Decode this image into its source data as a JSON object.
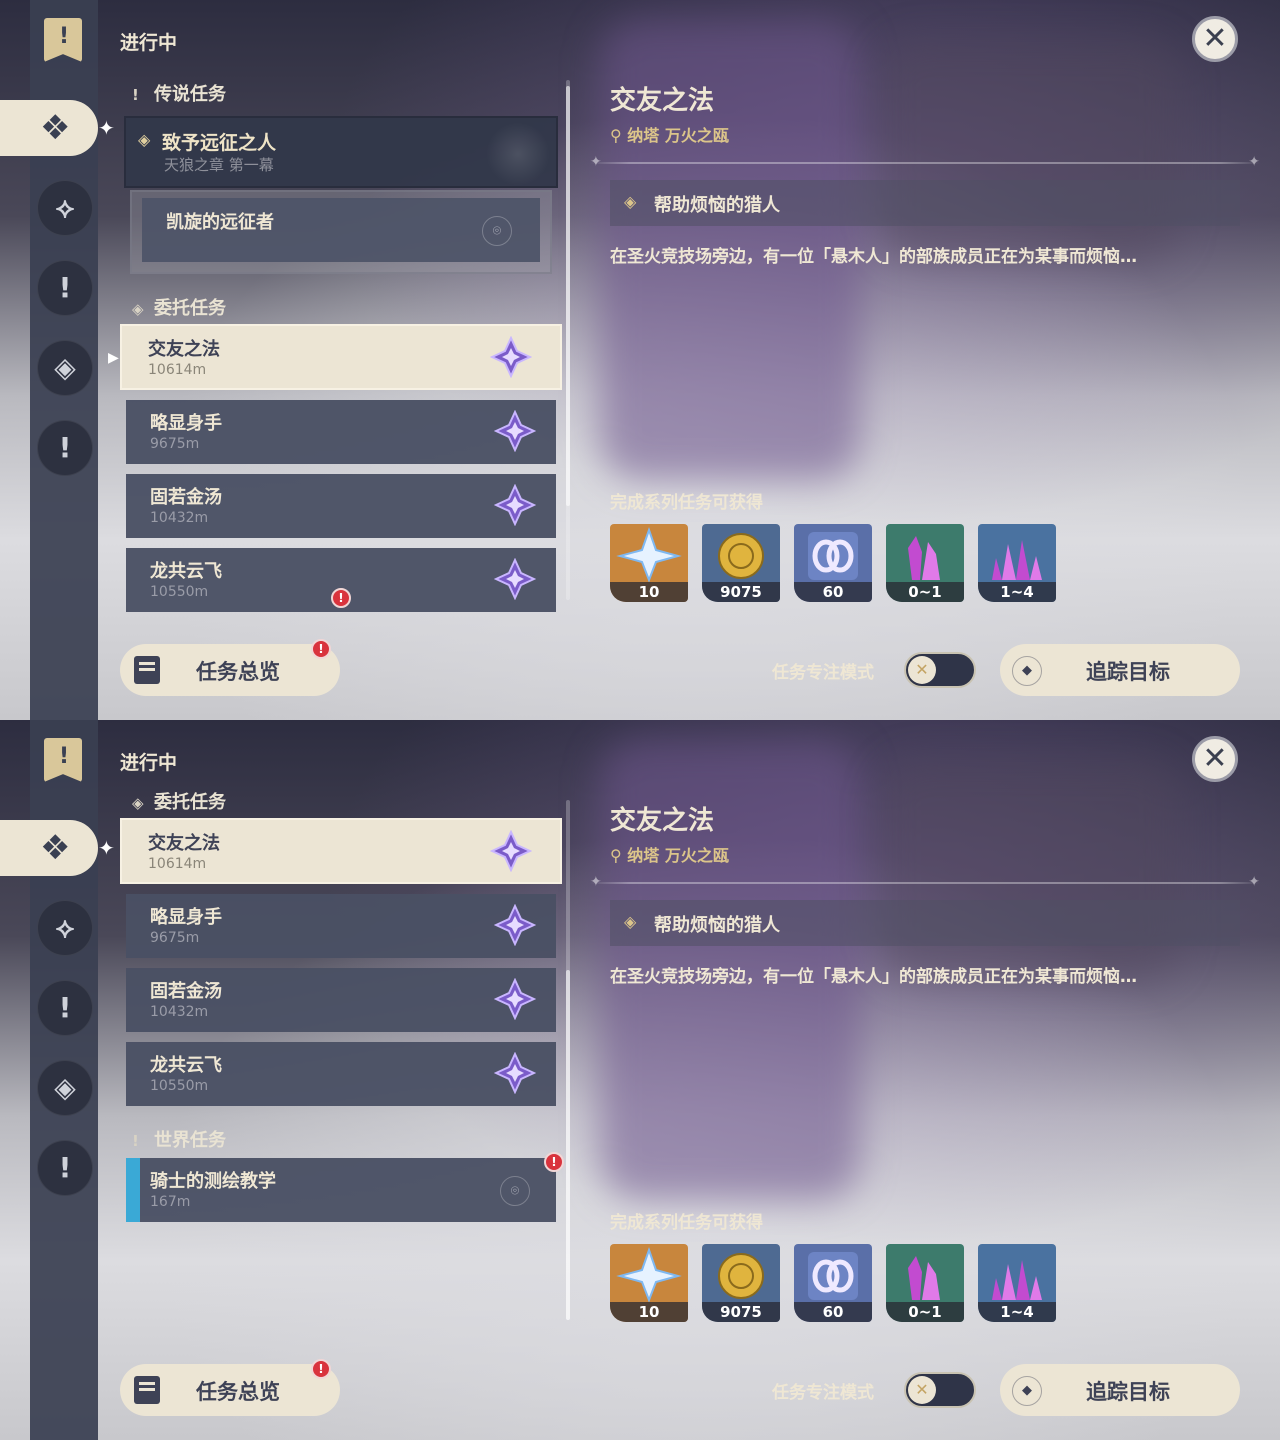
{
  "common": {
    "in_progress": "进行中",
    "overview_label": "任务总览",
    "focus_mode_label": "任务专注模式",
    "track_label": "追踪目标",
    "rewards_heading": "完成系列任务可获得"
  },
  "detail": {
    "title": "交友之法",
    "location": "纳塔 万火之瓯",
    "step": "帮助烦恼的猎人",
    "description": "在圣火竞技场旁边，有一位「悬木人」的部族成员正在为某事而烦恼…",
    "rewards": [
      {
        "icon": "primogem-icon",
        "count": "10"
      },
      {
        "icon": "mora-icon",
        "count": "9075"
      },
      {
        "icon": "adventure-exp-icon",
        "count": "60"
      },
      {
        "icon": "crystal-chunk-icon",
        "count": "0~1"
      },
      {
        "icon": "crystal-cluster-icon",
        "count": "1~4"
      }
    ]
  },
  "panel1": {
    "legend_section": "传说任务",
    "legend_quest_title": "致予远征之人",
    "legend_quest_chapter": "天狼之章 第一幕",
    "legend_sub_quest": "凯旋的远征者",
    "commission_section": "委托任务"
  },
  "panel2": {
    "commission_section": "委托任务",
    "world_section": "世界任务",
    "world_quest": {
      "name": "骑士的测绘教学",
      "dist": "167m"
    }
  },
  "commissions": [
    {
      "name": "交友之法",
      "dist": "10614m"
    },
    {
      "name": "略显身手",
      "dist": "9675m"
    },
    {
      "name": "固若金汤",
      "dist": "10432m"
    },
    {
      "name": "龙共云飞",
      "dist": "10550m"
    }
  ],
  "colors": {
    "cream": "#ece5d4",
    "gold": "#dcc58a",
    "alert_red": "#d9333d",
    "world_blue": "#3aa9d6",
    "commission_purple": "#7b5cc9"
  }
}
